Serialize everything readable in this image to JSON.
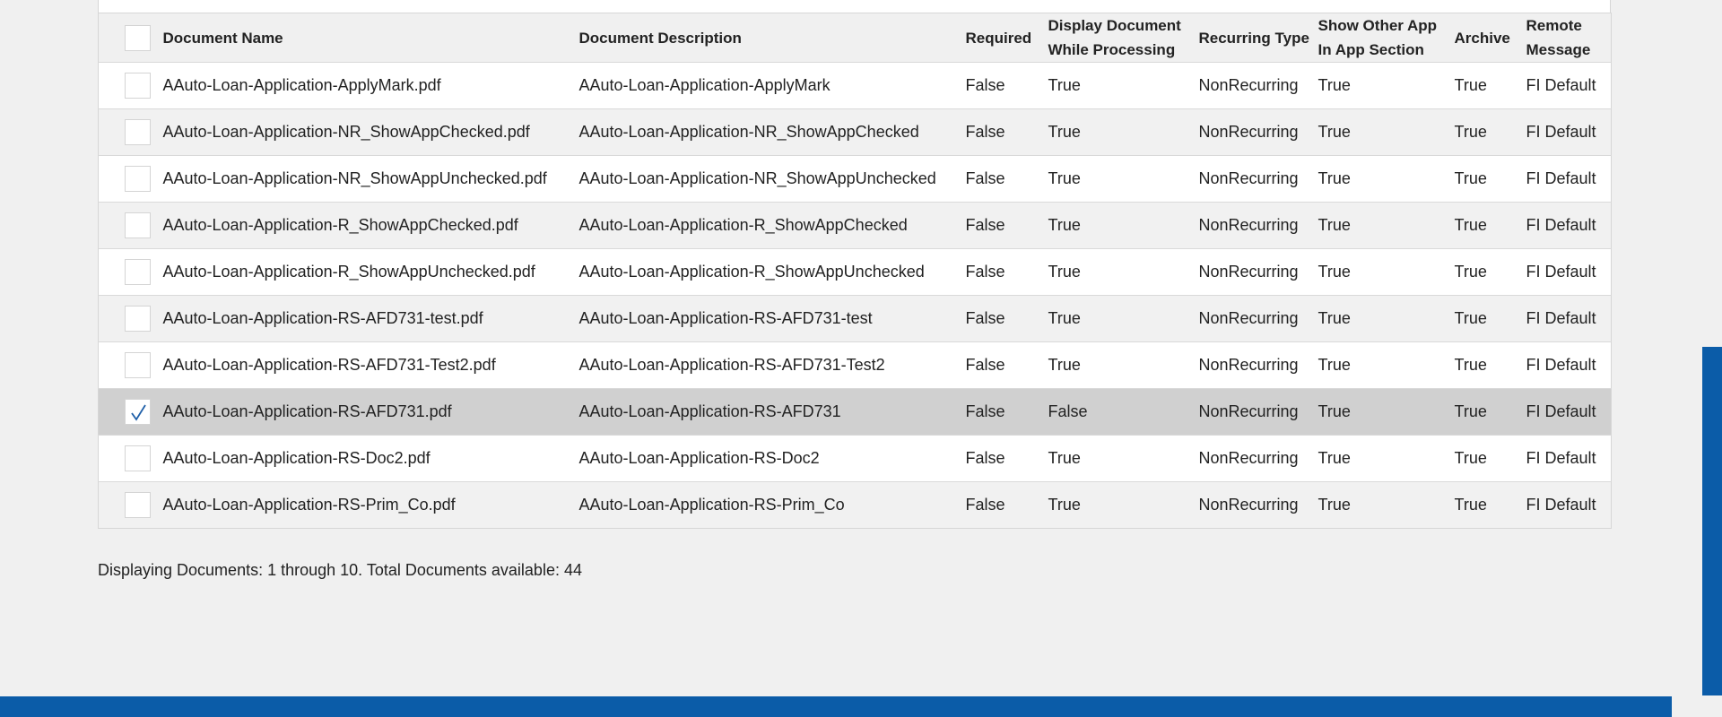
{
  "table": {
    "columns": [
      {
        "key": "select",
        "label": ""
      },
      {
        "key": "name",
        "label": "Document Name"
      },
      {
        "key": "description",
        "label": "Document Description"
      },
      {
        "key": "required",
        "label": "Required"
      },
      {
        "key": "display",
        "label": "Display Document While Processing"
      },
      {
        "key": "recurring",
        "label": "Recurring Type"
      },
      {
        "key": "show_other",
        "label": "Show Other App In App Section"
      },
      {
        "key": "archive",
        "label": "Archive"
      },
      {
        "key": "remote",
        "label": "Remote Message"
      }
    ],
    "header_checkbox_checked": false,
    "rows": [
      {
        "checked": false,
        "name": "AAuto-Loan-Application-ApplyMark.pdf",
        "description": "AAuto-Loan-Application-ApplyMark",
        "required": "False",
        "display": "True",
        "recurring": "NonRecurring",
        "show_other": "True",
        "archive": "True",
        "remote": "FI Default"
      },
      {
        "checked": false,
        "name": "AAuto-Loan-Application-NR_ShowAppChecked.pdf",
        "description": "AAuto-Loan-Application-NR_ShowAppChecked",
        "required": "False",
        "display": "True",
        "recurring": "NonRecurring",
        "show_other": "True",
        "archive": "True",
        "remote": "FI Default"
      },
      {
        "checked": false,
        "name": "AAuto-Loan-Application-NR_ShowAppUnchecked.pdf",
        "description": "AAuto-Loan-Application-NR_ShowAppUnchecked",
        "required": "False",
        "display": "True",
        "recurring": "NonRecurring",
        "show_other": "True",
        "archive": "True",
        "remote": "FI Default"
      },
      {
        "checked": false,
        "name": "AAuto-Loan-Application-R_ShowAppChecked.pdf",
        "description": "AAuto-Loan-Application-R_ShowAppChecked",
        "required": "False",
        "display": "True",
        "recurring": "NonRecurring",
        "show_other": "True",
        "archive": "True",
        "remote": "FI Default"
      },
      {
        "checked": false,
        "name": "AAuto-Loan-Application-R_ShowAppUnchecked.pdf",
        "description": "AAuto-Loan-Application-R_ShowAppUnchecked",
        "required": "False",
        "display": "True",
        "recurring": "NonRecurring",
        "show_other": "True",
        "archive": "True",
        "remote": "FI Default"
      },
      {
        "checked": false,
        "name": "AAuto-Loan-Application-RS-AFD731-test.pdf",
        "description": "AAuto-Loan-Application-RS-AFD731-test",
        "required": "False",
        "display": "True",
        "recurring": "NonRecurring",
        "show_other": "True",
        "archive": "True",
        "remote": "FI Default"
      },
      {
        "checked": false,
        "name": "AAuto-Loan-Application-RS-AFD731-Test2.pdf",
        "description": "AAuto-Loan-Application-RS-AFD731-Test2",
        "required": "False",
        "display": "True",
        "recurring": "NonRecurring",
        "show_other": "True",
        "archive": "True",
        "remote": "FI Default"
      },
      {
        "checked": true,
        "name": "AAuto-Loan-Application-RS-AFD731.pdf",
        "description": "AAuto-Loan-Application-RS-AFD731",
        "required": "False",
        "display": "False",
        "recurring": "NonRecurring",
        "show_other": "True",
        "archive": "True",
        "remote": "FI Default"
      },
      {
        "checked": false,
        "name": "AAuto-Loan-Application-RS-Doc2.pdf",
        "description": "AAuto-Loan-Application-RS-Doc2",
        "required": "False",
        "display": "True",
        "recurring": "NonRecurring",
        "show_other": "True",
        "archive": "True",
        "remote": "FI Default"
      },
      {
        "checked": false,
        "name": "AAuto-Loan-Application-RS-Prim_Co.pdf",
        "description": "AAuto-Loan-Application-RS-Prim_Co",
        "required": "False",
        "display": "True",
        "recurring": "NonRecurring",
        "show_other": "True",
        "archive": "True",
        "remote": "FI Default"
      }
    ]
  },
  "footer": {
    "status_text": "Displaying Documents: 1 through 10. Total Documents available: 44"
  },
  "colors": {
    "brand_blue": "#0b5ca8",
    "selected_row": "#d0d0d0",
    "check_mark": "#1f5fa8"
  },
  "icons": {
    "checkbox": "checkbox-icon",
    "checkmark": "checkmark-icon"
  }
}
